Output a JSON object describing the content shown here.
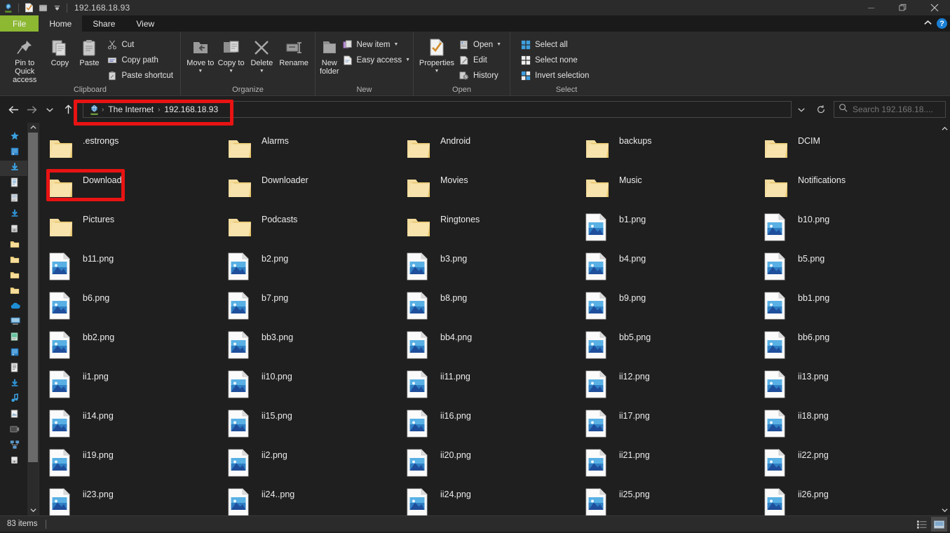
{
  "window": {
    "title": "192.168.18.93",
    "quick_access_icons": [
      "explorer-icon",
      "properties-icon",
      "folder-icon"
    ],
    "qat_dropdown": "customize-quick-access-caret",
    "controls": {
      "minimize": "–",
      "restore": "❐",
      "close": "✕"
    }
  },
  "ribbon": {
    "tabs": [
      {
        "label": "File",
        "state": "file"
      },
      {
        "label": "Home",
        "state": "active"
      },
      {
        "label": "Share",
        "state": ""
      },
      {
        "label": "View",
        "state": ""
      }
    ],
    "collapse_icon": "chevron-up-icon",
    "help_label": "?",
    "groups": [
      {
        "name": "Clipboard",
        "label": "Clipboard",
        "big": [
          {
            "label": "Pin to Quick access",
            "icon": "pin-icon"
          },
          {
            "label": "Copy",
            "icon": "copy-icon"
          },
          {
            "label": "Paste",
            "icon": "paste-icon"
          }
        ],
        "small": [
          {
            "label": "Cut",
            "icon": "scissors-icon"
          },
          {
            "label": "Copy path",
            "icon": "copy-path-icon"
          },
          {
            "label": "Paste shortcut",
            "icon": "paste-shortcut-icon"
          }
        ]
      },
      {
        "name": "Organize",
        "label": "Organize",
        "big": [
          {
            "label": "Move to",
            "icon": "move-to-icon",
            "caret": true
          },
          {
            "label": "Copy to",
            "icon": "copy-to-icon",
            "caret": true
          },
          {
            "label": "Delete",
            "icon": "delete-x-icon",
            "caret": true
          },
          {
            "label": "Rename",
            "icon": "rename-icon"
          }
        ],
        "small": []
      },
      {
        "name": "New",
        "label": "New",
        "big": [
          {
            "label": "New folder",
            "icon": "new-folder-icon"
          }
        ],
        "small": [
          {
            "label": "New item",
            "icon": "new-item-icon",
            "caret": true
          },
          {
            "label": "Easy access",
            "icon": "easy-access-icon",
            "caret": true
          }
        ]
      },
      {
        "name": "Open",
        "label": "Open",
        "big": [
          {
            "label": "Properties",
            "icon": "properties-icon",
            "caret": true
          }
        ],
        "small": [
          {
            "label": "Open",
            "icon": "open-icon",
            "caret": true
          },
          {
            "label": "Edit",
            "icon": "edit-icon"
          },
          {
            "label": "History",
            "icon": "history-icon"
          }
        ]
      },
      {
        "name": "Select",
        "label": "Select",
        "big": [],
        "small": [
          {
            "label": "Select all",
            "icon": "select-all-icon"
          },
          {
            "label": "Select none",
            "icon": "select-none-icon"
          },
          {
            "label": "Invert selection",
            "icon": "invert-selection-icon"
          }
        ]
      }
    ]
  },
  "addressbar": {
    "back_icon": "arrow-left-icon",
    "forward_icon": "arrow-right-icon",
    "recent_icon": "chevron-down-icon",
    "up_icon": "arrow-up-icon",
    "location_icon": "network-globe-icon",
    "breadcrumbs": [
      "The Internet",
      "192.168.18.93"
    ],
    "separator": "›",
    "dropdown_icon": "chevron-down-icon",
    "refresh_icon": "refresh-icon",
    "search_placeholder": "Search 192.168.18....",
    "search_value": "",
    "search_icon": "search-icon"
  },
  "navpane": {
    "items": [
      {
        "icon": "quick-access-star-icon",
        "selected": false
      },
      {
        "icon": "desktop-icon",
        "selected": false
      },
      {
        "icon": "downloads-icon",
        "selected": true
      },
      {
        "icon": "documents-icon",
        "selected": false
      },
      {
        "icon": "pictures-icon",
        "selected": false
      },
      {
        "icon": "downloads-blue-icon",
        "selected": false
      },
      {
        "icon": "drive-icon",
        "selected": false
      },
      {
        "icon": "folder-yellow-icon",
        "selected": false
      },
      {
        "icon": "folder-yellow-icon",
        "selected": false
      },
      {
        "icon": "folder-yellow-icon",
        "selected": false
      },
      {
        "icon": "folder-yellow-icon",
        "selected": false
      },
      {
        "icon": "onedrive-cloud-icon",
        "selected": false
      },
      {
        "icon": "this-pc-icon",
        "selected": false
      },
      {
        "icon": "desktop-green-icon",
        "selected": false
      },
      {
        "icon": "folder-blue-icon",
        "selected": false
      },
      {
        "icon": "documents-white-icon",
        "selected": false
      },
      {
        "icon": "downloads-blue-icon",
        "selected": false
      },
      {
        "icon": "music-icon",
        "selected": false
      },
      {
        "icon": "pictures-white-icon",
        "selected": false
      },
      {
        "icon": "videos-icon",
        "selected": false
      },
      {
        "icon": "network-icon",
        "selected": false
      },
      {
        "icon": "drive-c-icon",
        "selected": false
      }
    ],
    "scroll_up_icon": "chevron-up-icon",
    "scroll_down_icon": "chevron-down-icon"
  },
  "files": {
    "scroll_up_icon": "chevron-up-icon",
    "scroll_down_icon": "chevron-down-icon",
    "items": [
      {
        "name": ".estrongs",
        "type": "folder"
      },
      {
        "name": "Alarms",
        "type": "folder"
      },
      {
        "name": "Android",
        "type": "folder"
      },
      {
        "name": "backups",
        "type": "folder"
      },
      {
        "name": "DCIM",
        "type": "folder"
      },
      {
        "name": "Download",
        "type": "folder",
        "highlight": true
      },
      {
        "name": "Downloader",
        "type": "folder"
      },
      {
        "name": "Movies",
        "type": "folder"
      },
      {
        "name": "Music",
        "type": "folder"
      },
      {
        "name": "Notifications",
        "type": "folder"
      },
      {
        "name": "Pictures",
        "type": "folder"
      },
      {
        "name": "Podcasts",
        "type": "folder"
      },
      {
        "name": "Ringtones",
        "type": "folder"
      },
      {
        "name": "b1.png",
        "type": "png"
      },
      {
        "name": "b10.png",
        "type": "png"
      },
      {
        "name": "b11.png",
        "type": "png"
      },
      {
        "name": "b2.png",
        "type": "png"
      },
      {
        "name": "b3.png",
        "type": "png"
      },
      {
        "name": "b4.png",
        "type": "png"
      },
      {
        "name": "b5.png",
        "type": "png"
      },
      {
        "name": "b6.png",
        "type": "png"
      },
      {
        "name": "b7.png",
        "type": "png"
      },
      {
        "name": "b8.png",
        "type": "png"
      },
      {
        "name": "b9.png",
        "type": "png"
      },
      {
        "name": "bb1.png",
        "type": "png"
      },
      {
        "name": "bb2.png",
        "type": "png"
      },
      {
        "name": "bb3.png",
        "type": "png"
      },
      {
        "name": "bb4.png",
        "type": "png"
      },
      {
        "name": "bb5.png",
        "type": "png"
      },
      {
        "name": "bb6.png",
        "type": "png"
      },
      {
        "name": "ii1.png",
        "type": "png"
      },
      {
        "name": "ii10.png",
        "type": "png"
      },
      {
        "name": "ii11.png",
        "type": "png"
      },
      {
        "name": "ii12.png",
        "type": "png"
      },
      {
        "name": "ii13.png",
        "type": "png"
      },
      {
        "name": "ii14.png",
        "type": "png"
      },
      {
        "name": "ii15.png",
        "type": "png"
      },
      {
        "name": "ii16.png",
        "type": "png"
      },
      {
        "name": "ii17.png",
        "type": "png"
      },
      {
        "name": "ii18.png",
        "type": "png"
      },
      {
        "name": "ii19.png",
        "type": "png"
      },
      {
        "name": "ii2.png",
        "type": "png"
      },
      {
        "name": "ii20.png",
        "type": "png"
      },
      {
        "name": "ii21.png",
        "type": "png"
      },
      {
        "name": "ii22.png",
        "type": "png"
      },
      {
        "name": "ii23.png",
        "type": "png"
      },
      {
        "name": "ii24..png",
        "type": "png"
      },
      {
        "name": "ii24.png",
        "type": "png"
      },
      {
        "name": "ii25.png",
        "type": "png"
      },
      {
        "name": "ii26.png",
        "type": "png"
      }
    ]
  },
  "statusbar": {
    "item_count": "83 items",
    "view_details_icon": "details-view-icon",
    "view_largeicons_icon": "large-icons-view-icon"
  },
  "colors": {
    "file_tab_green": "#8cb832",
    "highlight_red": "#e81313",
    "folder_yellow": "#f5d98a",
    "accent_blue": "#1a7fd4"
  }
}
